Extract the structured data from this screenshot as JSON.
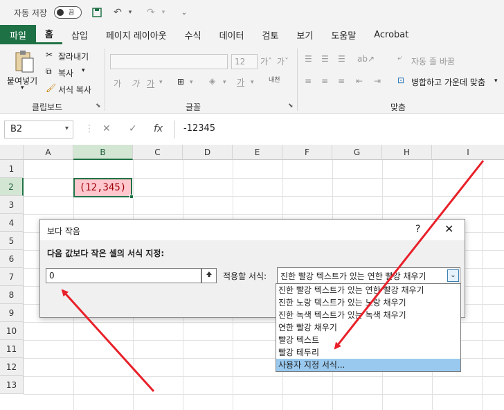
{
  "titlebar": {
    "autosave_label": "자동 저장",
    "autosave_state": "끔"
  },
  "ribbon_tabs": [
    "파일",
    "홈",
    "삽입",
    "페이지 레이아웃",
    "수식",
    "데이터",
    "검토",
    "보기",
    "도움말",
    "Acrobat"
  ],
  "ribbon": {
    "paste_label": "붙여넣기",
    "cut_label": "잘라내기",
    "copy_label": "복사",
    "format_painter_label": "서식 복사",
    "clipboard_group": "클립보드",
    "font_size": "12",
    "font_group": "글꼴",
    "wrap_text_label": "자동 줄 바꿈",
    "merge_center_label": "병합하고 가운데 맞춤",
    "alignment_group": "맞춤",
    "phonetic_label": "내천"
  },
  "formula_bar": {
    "name_box": "B2",
    "cancel": "✕",
    "enter": "✓",
    "fx": "fx",
    "formula": "-12345"
  },
  "grid": {
    "columns": [
      "A",
      "B",
      "C",
      "D",
      "E",
      "F",
      "G",
      "H",
      "I"
    ],
    "rows": [
      "1",
      "2",
      "3",
      "4",
      "5",
      "6",
      "7",
      "8",
      "9",
      "10",
      "11",
      "12",
      "13"
    ],
    "b2_value": "(12,345)"
  },
  "dialog": {
    "title": "보다 작음",
    "help": "?",
    "close": "✕",
    "prompt": "다음 값보다 작은 셀의 서식 지정:",
    "value": "0",
    "apply_label": "적용할 서식:",
    "selected_format": "진한 빨강 텍스트가 있는 연한 빨강 채우기",
    "options": [
      "진한 빨강 텍스트가 있는 연한 빨강 채우기",
      "진한 노랑 텍스트가 있는 노랑 채우기",
      "진한 녹색 텍스트가 있는 녹색 채우기",
      "연한 빨강 채우기",
      "빨강 텍스트",
      "빨강 테두리",
      "사용자 지정 서식..."
    ]
  },
  "colors": {
    "excel_green": "#217346",
    "cell_fill": "#ffc7ce",
    "cell_text": "#9c0006",
    "highlight": "#99c9ef",
    "arrow": "#e8202a"
  }
}
